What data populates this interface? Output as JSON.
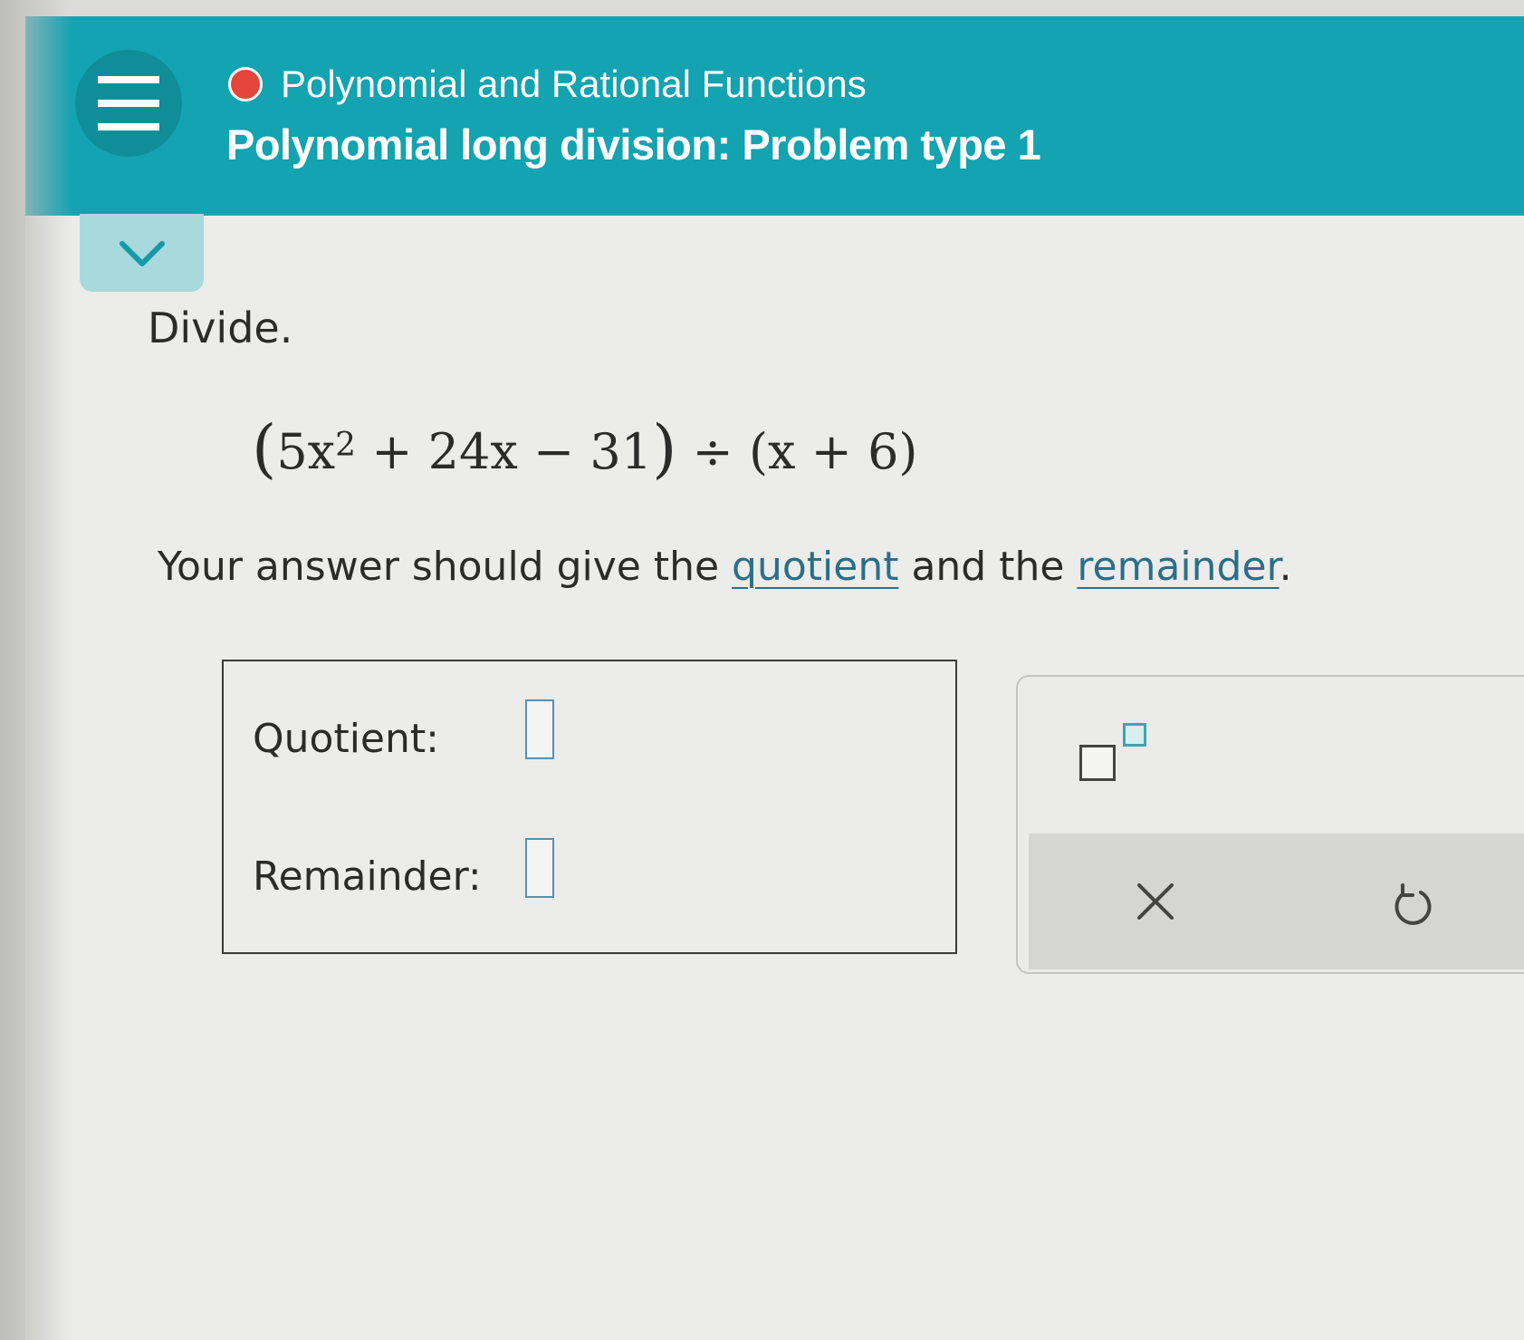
{
  "header": {
    "topic": "Polynomial and Rational Functions",
    "problem_title": "Polynomial long division: Problem type 1",
    "topic_dot_color": "#e5453a",
    "background_color": "#13a3b1"
  },
  "navigation": {
    "menu_icon": "hamburger-menu-icon",
    "collapse_icon": "chevron-down-icon"
  },
  "problem": {
    "prompt": "Divide.",
    "expression": {
      "open_paren": "(",
      "coef": "5x",
      "exponent": "2",
      "rest": " + 24x − 31",
      "close_paren": ")",
      "divide_sign": " ÷ ",
      "divisor": "(x + 6)"
    },
    "instruction": {
      "before": "Your answer should give the ",
      "link1": "quotient",
      "middle": " and the ",
      "link2": "remainder",
      "after": "."
    }
  },
  "answer": {
    "quotient_label": "Quotient:",
    "remainder_label": "Remainder:",
    "quotient_value": "",
    "remainder_value": ""
  },
  "tools": {
    "exponent_icon": "exponent-template-icon",
    "clear_icon": "close-icon",
    "undo_icon": "undo-icon",
    "accent_color": "#3aa6b3"
  }
}
